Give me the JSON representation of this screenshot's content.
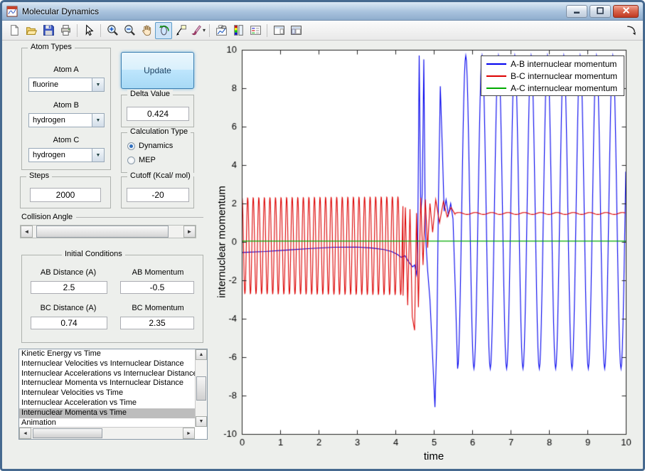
{
  "window": {
    "title": "Molecular Dynamics",
    "controls": [
      "minimize",
      "maximize",
      "close"
    ]
  },
  "toolbar": {
    "buttons": [
      {
        "name": "new-figure",
        "icon": "new-figure-icon"
      },
      {
        "name": "open-file",
        "icon": "open-file-icon"
      },
      {
        "name": "save-figure",
        "icon": "save-figure-icon"
      },
      {
        "name": "print-figure",
        "icon": "print-figure-icon",
        "sep_after": true
      },
      {
        "name": "edit-plot",
        "icon": "edit-plot-cursor-icon",
        "sep_after": true
      },
      {
        "name": "zoom-in",
        "icon": "zoom-in-icon"
      },
      {
        "name": "zoom-out",
        "icon": "zoom-out-icon"
      },
      {
        "name": "pan",
        "icon": "pan-hand-icon"
      },
      {
        "name": "rotate-3d",
        "icon": "rotate-3d-icon",
        "selected": true
      },
      {
        "name": "data-cursor",
        "icon": "data-cursor-icon"
      },
      {
        "name": "brush-data",
        "icon": "brush-icon",
        "caret": true,
        "sep_after": true
      },
      {
        "name": "link-plot",
        "icon": "link-plot-icon"
      },
      {
        "name": "insert-colorbar",
        "icon": "insert-colorbar-icon"
      },
      {
        "name": "insert-legend",
        "icon": "insert-legend-icon",
        "sep_after": true
      },
      {
        "name": "hide-plot-tools",
        "icon": "hide-plot-tools-icon"
      },
      {
        "name": "show-plot-tools",
        "icon": "show-plot-tools-icon"
      },
      {
        "name": "dock-figure",
        "icon": "dock-figure-icon",
        "align_right": true
      }
    ]
  },
  "panels": {
    "atom_types": {
      "title": "Atom Types",
      "fields": [
        {
          "label": "Atom A",
          "value": "fluorine"
        },
        {
          "label": "Atom B",
          "value": "hydrogen"
        },
        {
          "label": "Atom C",
          "value": "hydrogen"
        }
      ]
    },
    "update_button": "Update",
    "delta": {
      "title": "Delta Value",
      "value": "0.424"
    },
    "calculation_type": {
      "title": "Calculation Type",
      "options": [
        {
          "label": "Dynamics",
          "selected": true
        },
        {
          "label": "MEP",
          "selected": false
        }
      ]
    },
    "steps": {
      "title": "Steps",
      "value": "2000"
    },
    "cutoff": {
      "title": "Cutoff (Kcal/ mol)",
      "value": "-20"
    },
    "collision_angle": {
      "title": "Collision Angle"
    },
    "initial_conditions": {
      "title": "Initial Conditions",
      "fields": [
        {
          "label": "AB Distance (A)",
          "value": "2.5"
        },
        {
          "label": "AB Momentum",
          "value": "-0.5"
        },
        {
          "label": "BC Distance (A)",
          "value": "0.74"
        },
        {
          "label": "BC Momentum",
          "value": "2.35"
        }
      ]
    },
    "plot_list": {
      "items": [
        "Kinetic Energy vs Time",
        "Internuclear Velocities vs Internuclear Distance",
        "Internuclear Accelerations vs Internuclear Distance",
        "Internuclear Momenta vs Internuclear Distance",
        "Internulear Velocities vs Time",
        "Internuclear Acceleration vs Time",
        "Internuclear Momenta vs Time",
        "Animation"
      ],
      "selected_index": 6,
      "selected_item": "Internuclear Momenta vs Time"
    }
  },
  "chart_data": {
    "type": "line",
    "title": "",
    "xlabel": "time",
    "ylabel": "internuclear momentum",
    "xlim": [
      0,
      10
    ],
    "ylim": [
      -10,
      10
    ],
    "xticks": [
      0,
      1,
      2,
      3,
      4,
      5,
      6,
      7,
      8,
      9,
      10
    ],
    "yticks": [
      -10,
      -8,
      -6,
      -4,
      -2,
      0,
      2,
      4,
      6,
      8,
      10
    ],
    "grid": false,
    "legend_position": "top-right",
    "series": [
      {
        "name": "A-B internuclear momentum",
        "color": "#0000EE",
        "segments": [
          {
            "type": "points",
            "pts": [
              [
                0,
                -0.55
              ],
              [
                0.6,
                -0.5
              ],
              [
                1.2,
                -0.42
              ],
              [
                1.8,
                -0.34
              ],
              [
                2.4,
                -0.28
              ],
              [
                3.0,
                -0.27
              ],
              [
                3.4,
                -0.32
              ],
              [
                3.7,
                -0.4
              ],
              [
                3.9,
                -0.5
              ],
              [
                4.05,
                -0.65
              ],
              [
                4.15,
                -0.8
              ],
              [
                4.25,
                -0.72
              ],
              [
                4.35,
                -1.05
              ],
              [
                4.45,
                -1.3
              ],
              [
                4.5,
                -1.2
              ],
              [
                4.55,
                -1.7
              ]
            ]
          },
          {
            "type": "points",
            "pts": [
              [
                4.58,
                -0.5
              ],
              [
                4.62,
                9.7
              ],
              [
                4.66,
                1.5
              ],
              [
                4.7,
                2.5
              ],
              [
                4.74,
                9.5
              ],
              [
                4.78,
                0.5
              ],
              [
                4.84,
                -1.5
              ],
              [
                4.9,
                -3
              ],
              [
                4.97,
                -6
              ],
              [
                5.03,
                -8.6
              ],
              [
                5.08,
                -5
              ],
              [
                5.12,
                2
              ],
              [
                5.17,
                8.1
              ],
              [
                5.22,
                5
              ],
              [
                5.27,
                1.6
              ],
              [
                5.32,
                2.2
              ],
              [
                5.38,
                1.4
              ],
              [
                5.44,
                2.0
              ],
              [
                5.5,
                1.2
              ],
              [
                5.56,
                -2.5
              ],
              [
                5.62,
                -6.6
              ]
            ]
          },
          {
            "type": "osc",
            "t0": 5.62,
            "t1": 10,
            "mean": 1.55,
            "amp": 8.15,
            "freq": 2.35,
            "phase": -1.5708
          }
        ]
      },
      {
        "name": "B-C internuclear momentum",
        "color": "#DD0000",
        "segments": [
          {
            "type": "osc",
            "t0": 0,
            "t1": 4.2,
            "mean": -0.2,
            "amp": 2.5,
            "amp_end": 2.55,
            "freq": 6.9,
            "phase": 1.2
          },
          {
            "type": "points",
            "pts": [
              [
                4.2,
                -2.8
              ],
              [
                4.26,
                1.8
              ],
              [
                4.32,
                -3.3
              ],
              [
                4.38,
                1.7
              ],
              [
                4.44,
                -3.9
              ],
              [
                4.5,
                -4.6
              ],
              [
                4.55,
                1.5
              ],
              [
                4.6,
                -3.4
              ],
              [
                4.66,
                2.3
              ],
              [
                4.72,
                -1.2
              ],
              [
                4.78,
                2.2
              ],
              [
                4.84,
                -0.3
              ],
              [
                4.9,
                2.0
              ],
              [
                4.97,
                0.5
              ],
              [
                5.05,
                2.2
              ],
              [
                5.15,
                1.0
              ],
              [
                5.25,
                2.1
              ],
              [
                5.35,
                1.3
              ],
              [
                5.45,
                1.8
              ],
              [
                5.55,
                1.45
              ]
            ]
          },
          {
            "type": "osc",
            "t0": 5.55,
            "t1": 10,
            "mean": 1.48,
            "amp": 0.05,
            "freq": 2.35,
            "phase": 0
          }
        ]
      },
      {
        "name": "A-C internuclear momentum",
        "color": "#00AA00",
        "segments": [
          {
            "type": "points",
            "pts": [
              [
                0,
                0.04
              ],
              [
                10,
                0.04
              ]
            ]
          }
        ]
      }
    ]
  }
}
